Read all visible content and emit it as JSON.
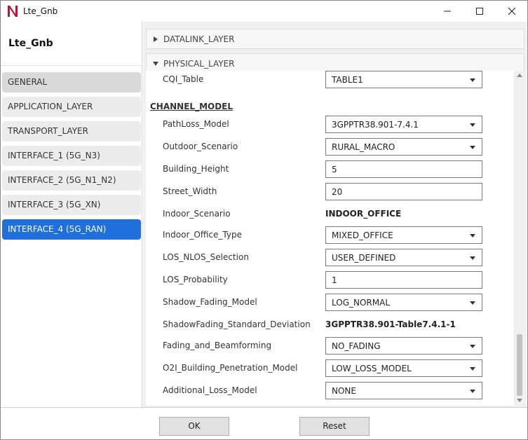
{
  "window": {
    "title": "Lte_Gnb",
    "logo_letter": "N"
  },
  "sidebar": {
    "device_name": "Lte_Gnb",
    "items": [
      {
        "label": "GENERAL"
      },
      {
        "label": "APPLICATION_LAYER"
      },
      {
        "label": "TRANSPORT_LAYER"
      },
      {
        "label": "INTERFACE_1 (5G_N3)"
      },
      {
        "label": "INTERFACE_2 (5G_N1_N2)"
      },
      {
        "label": "INTERFACE_3 (5G_XN)"
      },
      {
        "label": "INTERFACE_4 (5G_RAN)"
      }
    ],
    "selected": "INTERFACE_4 (5G_RAN)"
  },
  "accordion": {
    "datalink_label": "DATALINK_LAYER",
    "physical_label": "PHYSICAL_LAYER"
  },
  "physical": {
    "cqi_table": {
      "label": "CQI_Table",
      "value": "TABLE1"
    },
    "channel_model_title": "CHANNEL_MODEL",
    "pathloss_model": {
      "label": "PathLoss_Model",
      "value": "3GPPTR38.901-7.4.1"
    },
    "outdoor_scenario": {
      "label": "Outdoor_Scenario",
      "value": "RURAL_MACRO"
    },
    "building_height": {
      "label": "Building_Height",
      "value": "5"
    },
    "street_width": {
      "label": "Street_Width",
      "value": "20"
    },
    "indoor_scenario": {
      "label": "Indoor_Scenario",
      "value": "INDOOR_OFFICE"
    },
    "indoor_office_type": {
      "label": "Indoor_Office_Type",
      "value": "MIXED_OFFICE"
    },
    "los_nlos_selection": {
      "label": "LOS_NLOS_Selection",
      "value": "USER_DEFINED"
    },
    "los_probability": {
      "label": "LOS_Probability",
      "value": "1"
    },
    "shadow_fading_model": {
      "label": "Shadow_Fading_Model",
      "value": "LOG_NORMAL"
    },
    "shadowfading_std_dev": {
      "label": "ShadowFading_Standard_Deviation",
      "value": "3GPPTR38.901-Table7.4.1-1"
    },
    "fading_beamforming": {
      "label": "Fading_and_Beamforming",
      "value": "NO_FADING"
    },
    "o2i_penetration": {
      "label": "O2I_Building_Penetration_Model",
      "value": "LOW_LOSS_MODEL"
    },
    "additional_loss": {
      "label": "Additional_Loss_Model",
      "value": "NONE"
    }
  },
  "footer": {
    "ok_label": "OK",
    "reset_label": "Reset"
  },
  "colors": {
    "accent": "#1f6fdc",
    "logo_red": "#c8102e"
  }
}
